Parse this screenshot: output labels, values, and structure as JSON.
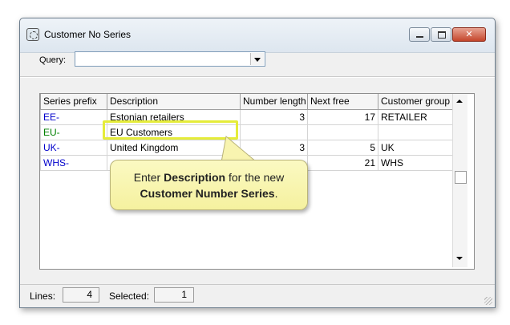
{
  "window": {
    "title": "Customer No Series"
  },
  "query": {
    "label": "Query:",
    "value": ""
  },
  "table": {
    "columns": [
      "Series prefix",
      "Description",
      "Number length",
      "Next free",
      "Customer group"
    ],
    "rows": [
      {
        "prefix": "EE-",
        "description": "Estonian retailers",
        "length": "3",
        "next_free": "17",
        "group": "RETAILER"
      },
      {
        "prefix": "EU-",
        "description": "EU Customers",
        "length": "",
        "next_free": "",
        "group": ""
      },
      {
        "prefix": "UK-",
        "description": "United Kingdom",
        "length": "3",
        "next_free": "5",
        "group": "UK"
      },
      {
        "prefix": "WHS-",
        "description": "",
        "length": "",
        "next_free": "21",
        "group": "WHS"
      }
    ]
  },
  "callout": {
    "pre": "Enter ",
    "bold1": "Description",
    "mid": " for the new",
    "bold2": "Customer Number Series",
    "end": "."
  },
  "status": {
    "lines_label": "Lines:",
    "lines_value": "4",
    "selected_label": "Selected:",
    "selected_value": "1"
  },
  "colors": {
    "prefix_blue": "#0000cc",
    "prefix_green": "#008000",
    "callout_bg": "#f5f19f",
    "highlight": "#e5ec3a"
  }
}
